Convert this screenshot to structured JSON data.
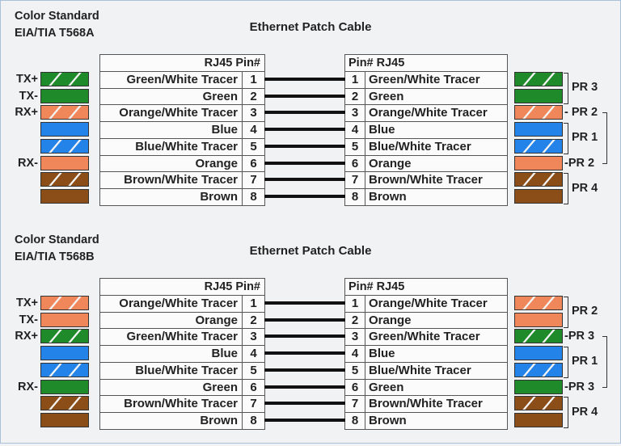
{
  "colors": {
    "green": "#1e8a2a",
    "orange": "#f0875a",
    "blue": "#2383e8",
    "brown": "#8b4e18"
  },
  "sections": [
    {
      "standard_line1": "Color  Standard",
      "standard_line2": "EIA/TIA T568A",
      "cable_title": "Ethernet Patch Cable",
      "left_header": "RJ45  Pin#",
      "right_header": "Pin#  RJ45",
      "rows": [
        {
          "pin": "1",
          "wire": "Green/White Tracer",
          "signal": "TX+",
          "color": "green",
          "striped": true
        },
        {
          "pin": "2",
          "wire": "Green",
          "signal": "TX-",
          "color": "green",
          "striped": false
        },
        {
          "pin": "3",
          "wire": "Orange/White Tracer",
          "signal": "RX+",
          "color": "orange",
          "striped": true
        },
        {
          "pin": "4",
          "wire": "Blue",
          "signal": "",
          "color": "blue",
          "striped": false
        },
        {
          "pin": "5",
          "wire": "Blue/White Tracer",
          "signal": "",
          "color": "blue",
          "striped": true
        },
        {
          "pin": "6",
          "wire": "Orange",
          "signal": "RX-",
          "color": "orange",
          "striped": false
        },
        {
          "pin": "7",
          "wire": "Brown/White Tracer",
          "signal": "",
          "color": "brown",
          "striped": true
        },
        {
          "pin": "8",
          "wire": "Brown",
          "signal": "",
          "color": "brown",
          "striped": false
        }
      ],
      "pairs": [
        {
          "label": "PR 3",
          "rows": [
            1,
            2
          ],
          "style": "bracket"
        },
        {
          "label": "- PR 2",
          "rows": [
            3
          ],
          "style": "split-top"
        },
        {
          "label": "PR 1",
          "rows": [
            4,
            5
          ],
          "style": "bracket"
        },
        {
          "label": "-PR 2",
          "rows": [
            6
          ],
          "style": "split-bottom"
        },
        {
          "label": "PR 4",
          "rows": [
            7,
            8
          ],
          "style": "bracket"
        }
      ]
    },
    {
      "standard_line1": "Color  Standard",
      "standard_line2": "EIA/TIA T568B",
      "cable_title": "Ethernet Patch Cable",
      "left_header": "RJ45  Pin#",
      "right_header": "Pin#  RJ45",
      "rows": [
        {
          "pin": "1",
          "wire": "Orange/White Tracer",
          "signal": "TX+",
          "color": "orange",
          "striped": true
        },
        {
          "pin": "2",
          "wire": "Orange",
          "signal": "TX-",
          "color": "orange",
          "striped": false
        },
        {
          "pin": "3",
          "wire": "Green/White Tracer",
          "signal": "RX+",
          "color": "green",
          "striped": true
        },
        {
          "pin": "4",
          "wire": "Blue",
          "signal": "",
          "color": "blue",
          "striped": false
        },
        {
          "pin": "5",
          "wire": "Blue/White Tracer",
          "signal": "",
          "color": "blue",
          "striped": true
        },
        {
          "pin": "6",
          "wire": "Green",
          "signal": "RX-",
          "color": "green",
          "striped": false
        },
        {
          "pin": "7",
          "wire": "Brown/White Tracer",
          "signal": "",
          "color": "brown",
          "striped": true
        },
        {
          "pin": "8",
          "wire": "Brown",
          "signal": "",
          "color": "brown",
          "striped": false
        }
      ],
      "pairs": [
        {
          "label": "PR 2",
          "rows": [
            1,
            2
          ],
          "style": "bracket"
        },
        {
          "label": "-PR 3",
          "rows": [
            3
          ],
          "style": "split-top"
        },
        {
          "label": "PR 1",
          "rows": [
            4,
            5
          ],
          "style": "bracket"
        },
        {
          "label": "-PR 3",
          "rows": [
            6
          ],
          "style": "split-bottom"
        },
        {
          "label": "PR 4",
          "rows": [
            7,
            8
          ],
          "style": "bracket"
        }
      ]
    }
  ]
}
